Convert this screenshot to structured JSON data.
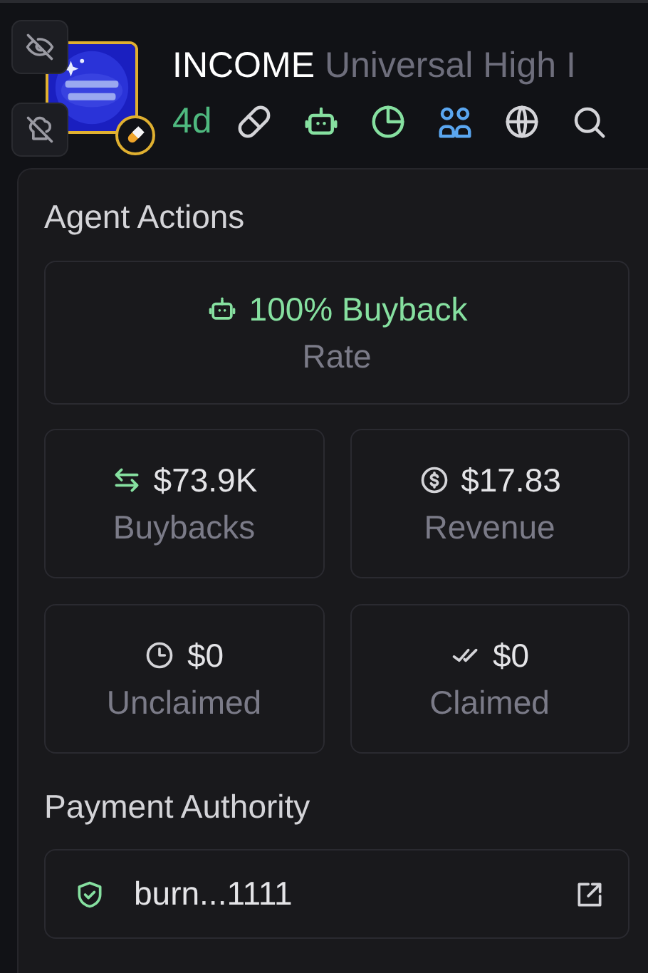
{
  "token": {
    "symbol": "INCOME",
    "name": "Universal High I",
    "age": "4d"
  },
  "agent_actions": {
    "title": "Agent Actions",
    "rate": {
      "value": "100% Buyback",
      "label": "Rate"
    },
    "stats": [
      {
        "kind": "buybacks",
        "value": "$73.9K",
        "label": "Buybacks"
      },
      {
        "kind": "revenue",
        "value": "$17.83",
        "label": "Revenue"
      },
      {
        "kind": "unclaimed",
        "value": "$0",
        "label": "Unclaimed"
      },
      {
        "kind": "claimed",
        "value": "$0",
        "label": "Claimed"
      }
    ]
  },
  "payment_authority": {
    "title": "Payment Authority",
    "address": "burn...1111"
  }
}
